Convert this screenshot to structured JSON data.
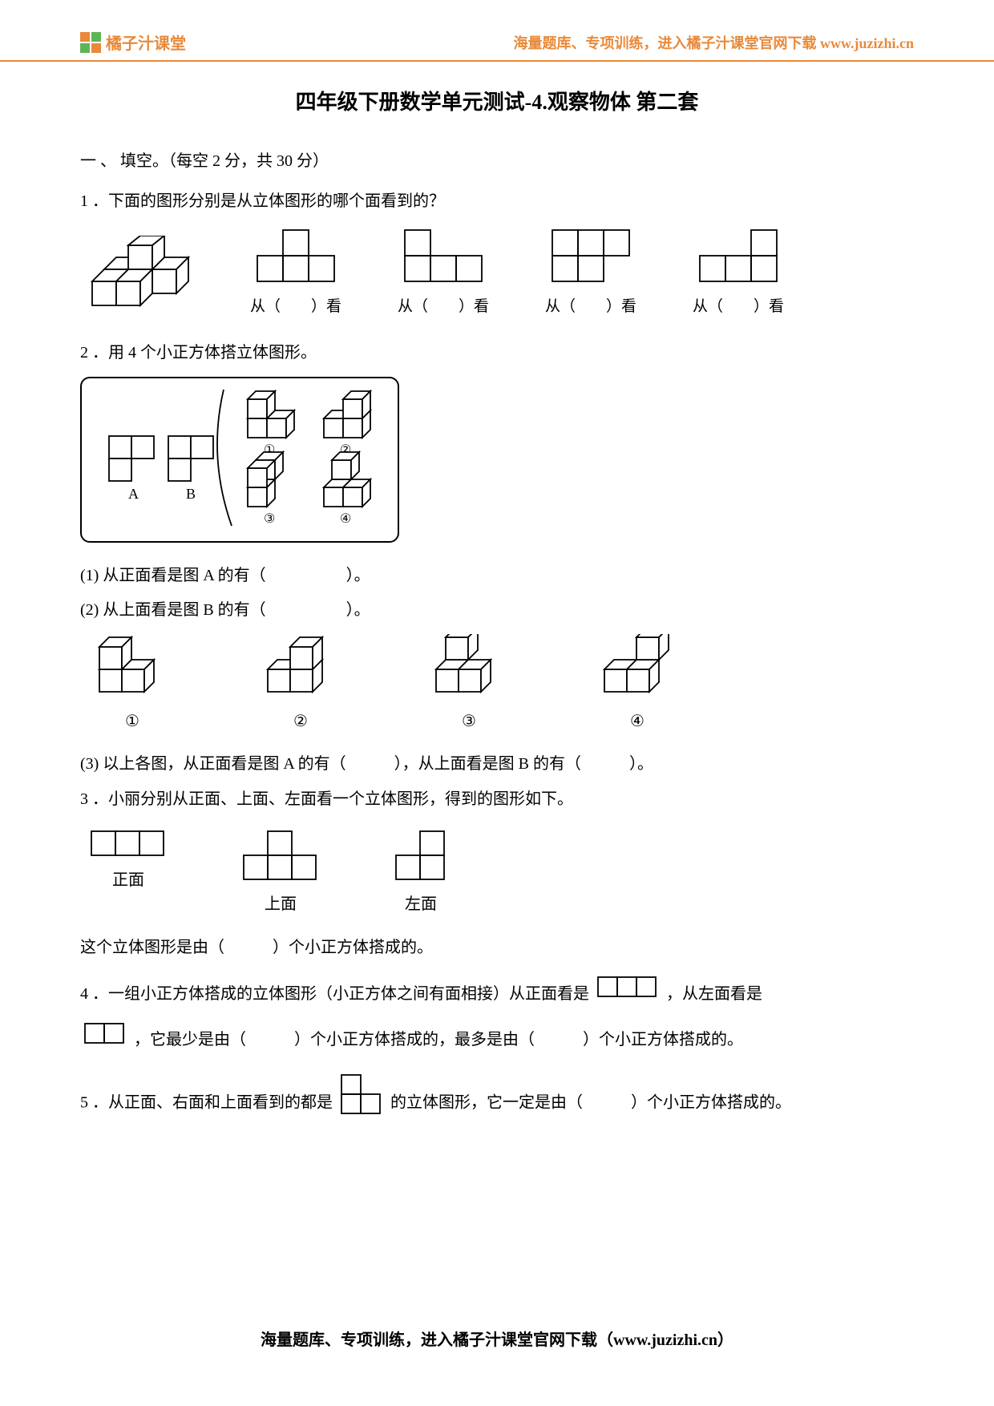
{
  "header": {
    "logo_text": "橘子汁课堂",
    "header_right": "海量题库、专项训练，进入橘子汁课堂官网下载 www.juzizhi.cn"
  },
  "title": "四年级下册数学单元测试-4.观察物体 第二套",
  "section1": {
    "label": "一 、 填空。（每空 2 分，共 30 分）",
    "q1": {
      "text": "1 ．下面的图形分别是从立体图形的哪个面看到的？",
      "labels": [
        "从（　　）看",
        "从（　　）看",
        "从（　　）看",
        "从（　　）看"
      ]
    },
    "q2": {
      "text": "2 ．用 4 个小正方体搭立体图形。",
      "sub1": "(1) 从正面看是图 A 的有（　　　　　）。",
      "sub2": "(2) 从上面看是图 B 的有（　　　　　）。",
      "sub3": "(3) 以上各图，从正面看是图 A 的有（　　　），从上面看是图 B 的有（　　　）。",
      "circled": [
        "①",
        "②",
        "③",
        "④"
      ]
    },
    "q3": {
      "text": "3 ．小丽分别从正面、上面、左面看一个立体图形，得到的图形如下。",
      "view_labels": [
        "正面",
        "上面",
        "左面"
      ],
      "followup": "这个立体图形是由（　　　）个小正方体搭成的。"
    },
    "q4": {
      "part1": "4 ．一组小正方体搭成的立体图形（小正方体之间有面相接）从正面看是 ",
      "part2": "，从左面看是",
      "part3": "，它最少是由（　　　）个小正方体搭成的，最多是由（　　　）个小正方体搭成的。"
    },
    "q5": {
      "part1": "5 ．从正面、右面和上面看到的都是 ",
      "part2": "的立体图形，它一定是由（　　　）个小正方体搭成的。"
    }
  },
  "footer": "海量题库、专项训练，进入橘子汁课堂官网下载（www.juzizhi.cn）"
}
